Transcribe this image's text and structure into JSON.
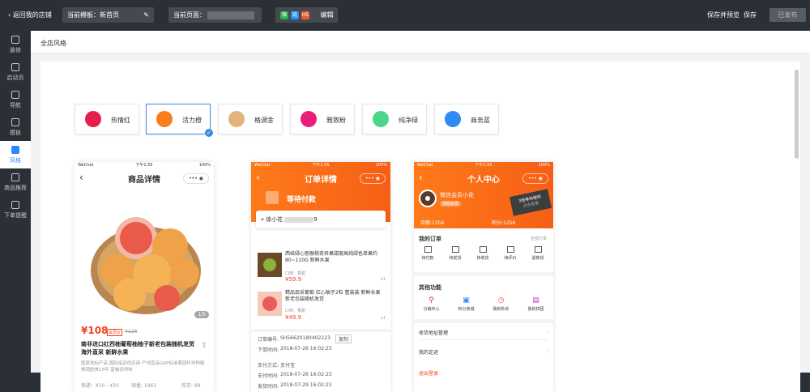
{
  "topbar": {
    "back_label": "‹ 返回我的店铺",
    "template_label": "当前模板：新首页",
    "page_label": "当前页面：",
    "edit_label": "编辑",
    "save_preview": "保存并预览",
    "save": "保存",
    "published": "已发布",
    "share_icons": [
      "微",
      "链",
      "H5"
    ]
  },
  "sidebar": {
    "items": [
      {
        "label": "装修"
      },
      {
        "label": "启动页"
      },
      {
        "label": "导航"
      },
      {
        "label": "模板"
      },
      {
        "label": "风格"
      },
      {
        "label": "商品推荐"
      },
      {
        "label": "下单提醒"
      }
    ],
    "active_index": 4
  },
  "main": {
    "header": "全店风格"
  },
  "styles": [
    {
      "label": "热情红",
      "color": "#e61e4d"
    },
    {
      "label": "活力橙",
      "color": "#f97c1f",
      "selected": true
    },
    {
      "label": "格调金",
      "color": "#e2b47c"
    },
    {
      "label": "雅致粉",
      "color": "#e91e79"
    },
    {
      "label": "纯净绿",
      "color": "#4cd68a"
    },
    {
      "label": "商务蓝",
      "color": "#2c8cf4"
    }
  ],
  "phone1": {
    "carrier": "WeChat",
    "time": "下午1:55",
    "battery": "100%",
    "title": "商品详情",
    "counter": "1/5",
    "price": "¥108",
    "price_tag": "会员价",
    "old_price": "¥128",
    "name": "南非进口红西柚葡萄柚柚子新老包装随机发货 海外直采 新鲜水果",
    "desc": "国家地标产品 国际指定供应商 产地直采GAP标准果园科学种植 畅销欧美15年 富柚货柯味",
    "range": "快递：¥10 - ¥20",
    "sales": "销量: 1965",
    "stock": "库存: 89"
  },
  "phone2": {
    "carrier": "WeChat",
    "time": "下午1:55",
    "battery": "100%",
    "title": "订单详情",
    "status": "等待付款",
    "receiver": "徐小花",
    "receiver_tail": "9",
    "items": [
      {
        "name": "西岐绿心猕猴桃奇异果甜度高纯绿色单果约80~110G 新鲜水果",
        "spec": "口味：香甜",
        "price": "¥59.9",
        "qty": "x1"
      },
      {
        "name": "精品现采葡萄 红心柚子2粒 整装装 新鲜水果 新老包装随机发货",
        "spec": "口味：香甜",
        "price": "¥49.9",
        "qty": "x1"
      }
    ],
    "order_no_label": "订单编号:",
    "order_no": "SH56620180402223",
    "copy": "复制",
    "order_time_label": "下单时间:",
    "order_time": "2018-07-26 16:02:23",
    "pay_method_label": "支付方式:",
    "pay_method": "支付宝",
    "pay_time_label": "支付时间:",
    "pay_time": "2018-07-26 16:02:23",
    "ship_time_label": "发货时间:",
    "ship_time": "2018-07-29 16:02:23"
  },
  "phone3": {
    "carrier": "WeChat",
    "time": "下午1:55",
    "battery": "100%",
    "title": "个人中心",
    "username": "微信会员小花",
    "member_tag": "领取会员",
    "coupon": "3张券待使用",
    "coupon_sub": "点击查看",
    "balance": "余额:1256",
    "points": "积分:1256",
    "orders_title": "我的订单",
    "orders_all": "全部订单",
    "order_tabs": [
      "待付款",
      "待发货",
      "待收货",
      "待评价",
      "退换货"
    ],
    "funcs_title": "其他功能",
    "funcs": [
      "分销中心",
      "积分商城",
      "我的秒杀",
      "我的拼团"
    ],
    "links": [
      "收货地址管理",
      "我的足迹"
    ],
    "logout": "退出登录"
  }
}
